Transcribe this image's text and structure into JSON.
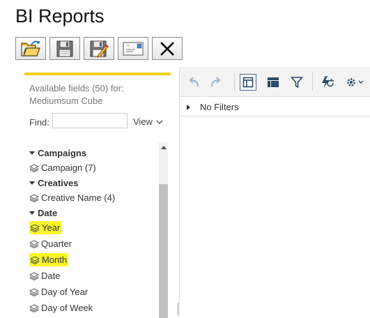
{
  "page": {
    "title": "BI Reports"
  },
  "toolbar": {
    "buttons": [
      {
        "name": "open-button",
        "icon": "folder-open-icon"
      },
      {
        "name": "save-button",
        "icon": "floppy-disk-icon"
      },
      {
        "name": "save-as-button",
        "icon": "floppy-edit-icon"
      },
      {
        "name": "email-button",
        "icon": "envelope-icon"
      },
      {
        "name": "close-button",
        "icon": "close-x-icon"
      }
    ]
  },
  "fields_panel": {
    "available_line1": "Available fields (50) for:",
    "available_line2": "Mediumsum Cube",
    "find_label": "Find:",
    "find_value": "",
    "view_label": "View",
    "accent_color": "#f2cf1c",
    "highlight_color": "#f8f529",
    "groups": [
      {
        "label": "Campaigns",
        "fields": [
          {
            "label": "Campaign (7)",
            "highlighted": false
          }
        ]
      },
      {
        "label": "Creatives",
        "fields": [
          {
            "label": "Creative Name (4)",
            "highlighted": false
          }
        ]
      },
      {
        "label": "Date",
        "fields": [
          {
            "label": "Year",
            "highlighted": true
          },
          {
            "label": "Quarter",
            "highlighted": false
          },
          {
            "label": "Month",
            "highlighted": true
          },
          {
            "label": "Date",
            "highlighted": false
          },
          {
            "label": "Day of Year",
            "highlighted": false
          },
          {
            "label": "Day of Week",
            "highlighted": false
          }
        ]
      }
    ]
  },
  "report_panel": {
    "toolbar_icons": [
      "undo-icon",
      "redo-icon",
      "layout-panel-icon",
      "table-layout-icon",
      "filter-icon",
      "refresh-lightning-icon",
      "settings-gear-icon"
    ],
    "filters_label": "No Filters"
  }
}
